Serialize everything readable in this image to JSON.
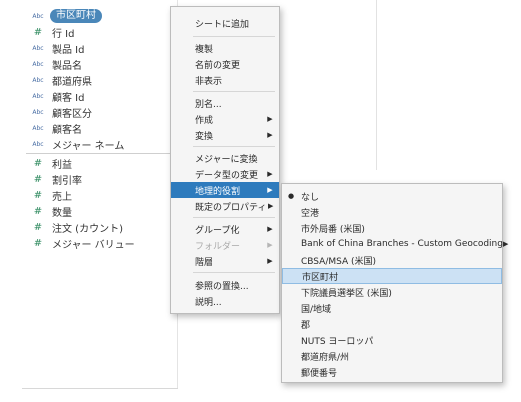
{
  "data_pane": {
    "dimensions": [
      {
        "type": "Abc",
        "label": "市区町村",
        "selected": true
      },
      {
        "type": "#",
        "label": "行 Id"
      },
      {
        "type": "Abc",
        "label": "製品 Id"
      },
      {
        "type": "Abc",
        "label": "製品名"
      },
      {
        "type": "Abc",
        "label": "都道府県"
      },
      {
        "type": "Abc",
        "label": "顧客 Id"
      },
      {
        "type": "Abc",
        "label": "顧客区分"
      },
      {
        "type": "Abc",
        "label": "顧客名"
      },
      {
        "type": "Abc",
        "label": "メジャー ネーム"
      }
    ],
    "measures": [
      {
        "type": "#",
        "label": "利益"
      },
      {
        "type": "#",
        "label": "割引率"
      },
      {
        "type": "#",
        "label": "売上"
      },
      {
        "type": "#",
        "label": "数量"
      },
      {
        "type": "#",
        "label": "注文 (カウント)"
      },
      {
        "type": "#",
        "label": "メジャー バリュー"
      }
    ]
  },
  "context_menu": {
    "items": [
      {
        "label": "シートに追加"
      },
      {
        "label": "複製"
      },
      {
        "label": "名前の変更"
      },
      {
        "label": "非表示"
      },
      {
        "label": "別名..."
      },
      {
        "label": "作成",
        "submenu": true
      },
      {
        "label": "変換",
        "submenu": true
      },
      {
        "label": "メジャーに変換"
      },
      {
        "label": "データ型の変更",
        "submenu": true
      },
      {
        "label": "地理的役割",
        "submenu": true,
        "active": true
      },
      {
        "label": "既定のプロパティ",
        "submenu": true
      },
      {
        "label": "グループ化",
        "submenu": true
      },
      {
        "label": "フォルダー",
        "submenu": true,
        "disabled": true
      },
      {
        "label": "階層",
        "submenu": true
      },
      {
        "label": "参照の置換..."
      },
      {
        "label": "説明..."
      }
    ]
  },
  "geo_submenu": {
    "items": [
      {
        "label": "なし",
        "checked": true
      },
      {
        "label": "空港"
      },
      {
        "label": "市外局番 (米国)"
      },
      {
        "label": "Bank of China Branches - Custom Geocoding",
        "submenu": true
      },
      {
        "label": "CBSA/MSA (米国)"
      },
      {
        "label": "市区町村",
        "highlight": true
      },
      {
        "label": "下院議員選挙区 (米国)"
      },
      {
        "label": "国/地域"
      },
      {
        "label": "郡"
      },
      {
        "label": "NUTS ヨーロッパ"
      },
      {
        "label": "都道府県/州"
      },
      {
        "label": "郵便番号"
      }
    ]
  },
  "icons": {
    "dimension": "abc-type-icon",
    "measure": "number-type-icon",
    "submenu": "triangle-right-icon",
    "check": "bullet-icon"
  },
  "colors": {
    "selection": "#4a87b9",
    "menu_active": "#2e7bbd",
    "menu_highlight": "#cce1f4"
  }
}
